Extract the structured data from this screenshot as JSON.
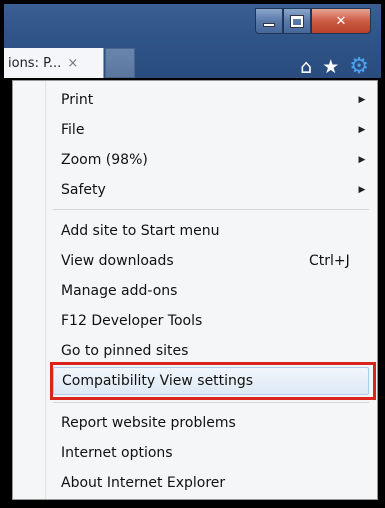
{
  "window": {
    "tab_title": "ions: P...",
    "tab_close": "×"
  },
  "toolbar": {
    "home_icon": "home-icon",
    "favorites_icon": "star-icon",
    "tools_icon": "gear-icon"
  },
  "menu": {
    "groups": [
      [
        {
          "label": "Print",
          "submenu": true
        },
        {
          "label": "File",
          "submenu": true
        },
        {
          "label": "Zoom (98%)",
          "submenu": true
        },
        {
          "label": "Safety",
          "submenu": true
        }
      ],
      [
        {
          "label": "Add site to Start menu"
        },
        {
          "label": "View downloads",
          "shortcut": "Ctrl+J"
        },
        {
          "label": "Manage add-ons"
        },
        {
          "label": "F12 Developer Tools"
        },
        {
          "label": "Go to pinned sites"
        },
        {
          "label": "Compatibility View settings",
          "highlighted": true
        }
      ],
      [
        {
          "label": "Report website problems"
        },
        {
          "label": "Internet options"
        },
        {
          "label": "About Internet Explorer"
        }
      ]
    ]
  },
  "colors": {
    "chrome": "#2f5487",
    "highlight_border": "#d9251c",
    "gear": "#4aa3f2"
  }
}
